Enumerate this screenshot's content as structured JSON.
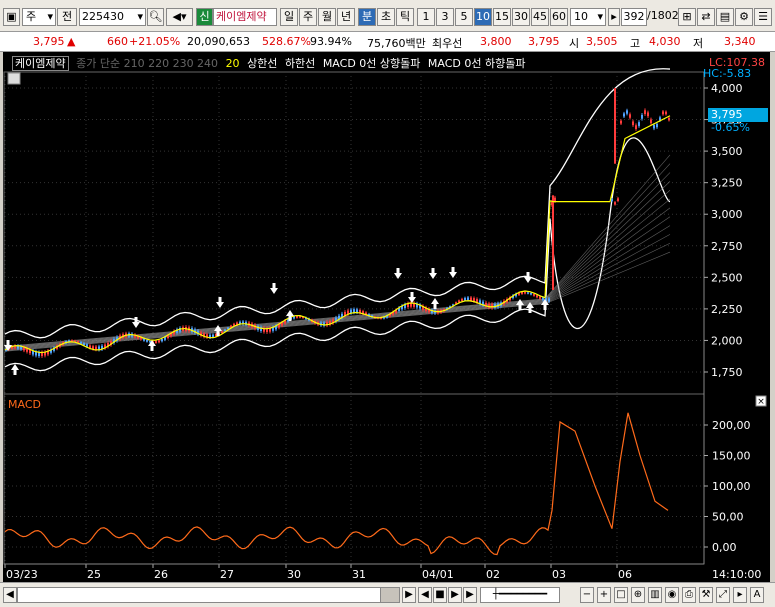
{
  "toolbar": {
    "market": "주",
    "prev": "전",
    "code": "225430",
    "badge": "신",
    "name": "케이엠제약",
    "periods": [
      "일",
      "주",
      "월",
      "년",
      "분",
      "초",
      "틱"
    ],
    "active_period": "분",
    "minutes": [
      "1",
      "3",
      "5",
      "10",
      "15",
      "30",
      "45",
      "60"
    ],
    "active_minute": "10",
    "count": "10",
    "position": "392",
    "total": "/1802"
  },
  "quote": {
    "price": "3,795",
    "arrow": "▲",
    "change": "660",
    "change_pct": "+21.05%",
    "volume": "20,090,653",
    "vol_ratio": "528.67%",
    "strength": "93.94%",
    "amount": "75,760백만",
    "best_label": "최우선",
    "ask": "3,800",
    "bid": "3,795",
    "open_label": "시",
    "open": "3,505",
    "high_label": "고",
    "high": "4,030",
    "low_label": "저",
    "low": "3,340"
  },
  "legend": {
    "name": "케이엠제약",
    "ma_text": "종가 단순 210  220  230  240",
    "item20": "20",
    "upper": "상한선",
    "lower": "하한선",
    "macd_up": "MACD 0선 상향돌파",
    "macd_down": "MACD 0선 하향돌파"
  },
  "price_axis": {
    "lc": "LC:107.38",
    "hc": "HC:-5.83",
    "ticks": [
      "4,000",
      "3,750",
      "3,500",
      "3,250",
      "3,000",
      "2,750",
      "2,500",
      "2,250",
      "2,000",
      "1,750"
    ],
    "current": "3,795",
    "current_pct": "-0.65%"
  },
  "macd_panel": {
    "title": "MACD",
    "ticks": [
      "200,00",
      "150,00",
      "100,00",
      "50,00",
      "0,00"
    ]
  },
  "time_axis": {
    "labels": [
      "03/23",
      "25",
      "26",
      "27",
      "30",
      "31",
      "04/01",
      "02",
      "03",
      "06"
    ],
    "clock": "14:10:00"
  },
  "colors": {
    "up": "#ff3b3b",
    "down": "#4fa3ff",
    "ma20": "#ffff00",
    "macd": "#ff6a1a",
    "band": "#ffffff",
    "grid": "#555555"
  }
}
